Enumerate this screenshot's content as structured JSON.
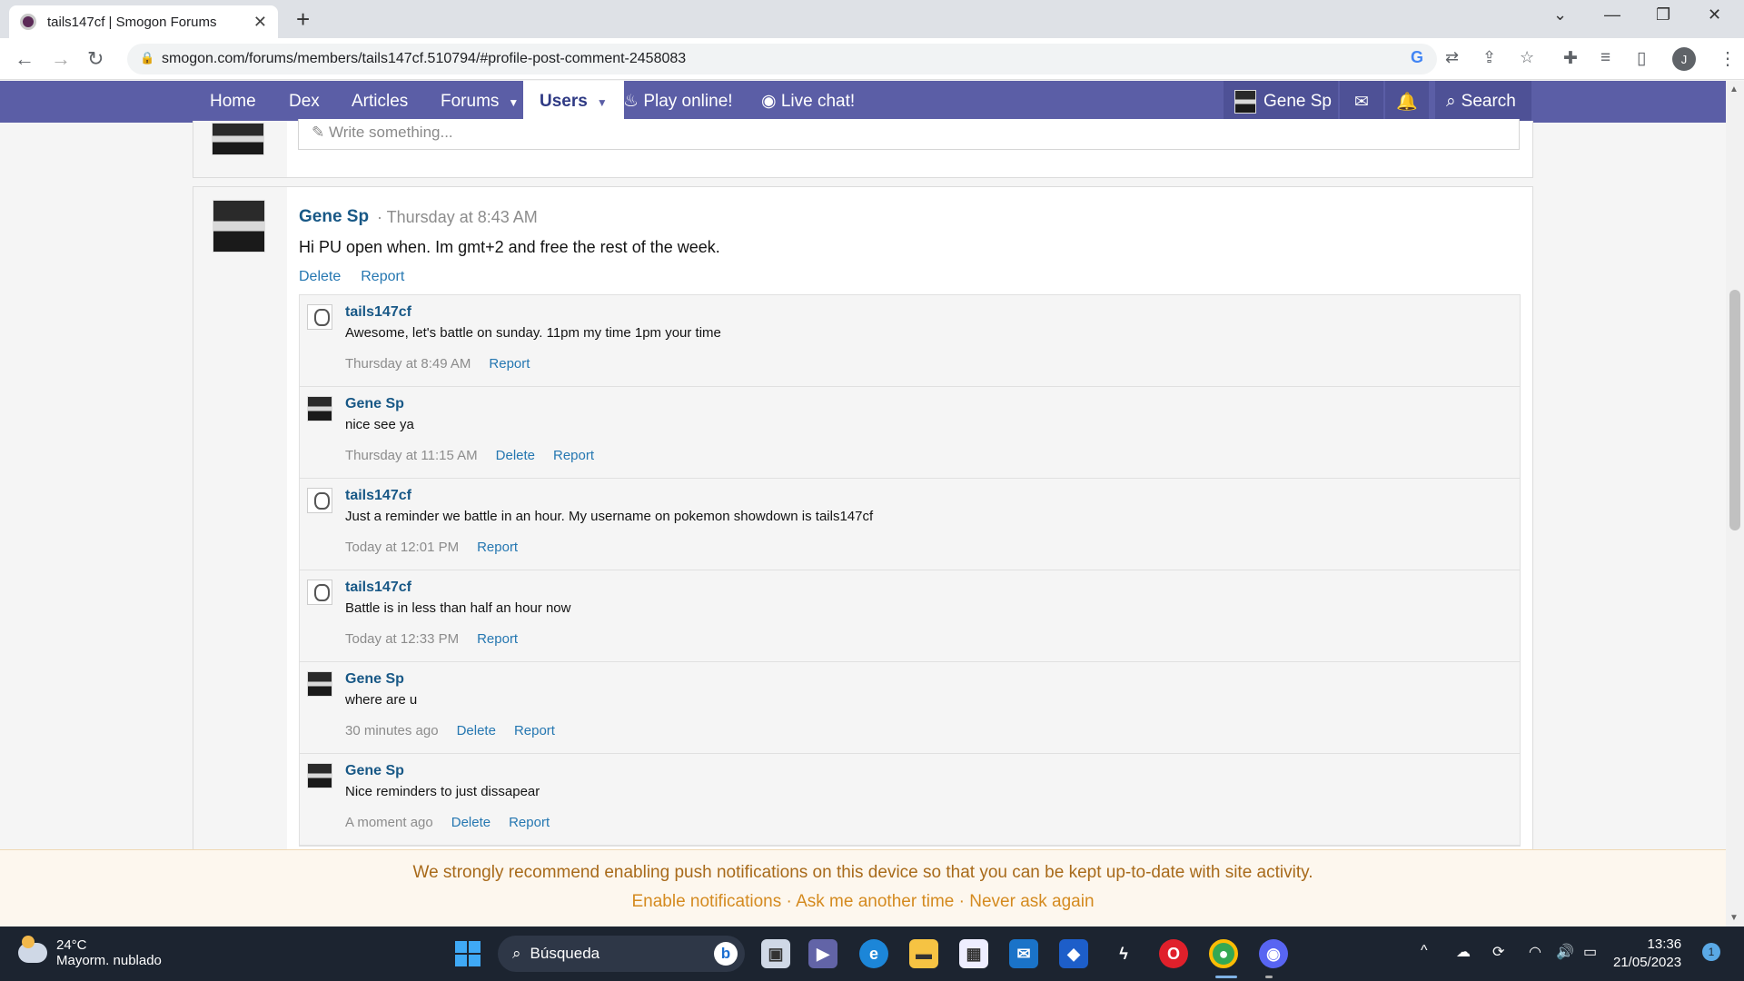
{
  "browser": {
    "tab_title": "tails147cf | Smogon Forums",
    "url": "smogon.com/forums/members/tails147cf.510794/#profile-post-comment-2458083",
    "profile_initial": "J"
  },
  "site_nav": {
    "items": [
      "Home",
      "Dex",
      "Articles",
      "Forums",
      "Users",
      "Play online!",
      "Live chat!"
    ],
    "user": "Gene Sp",
    "search": "Search"
  },
  "composer": {
    "placeholder": "Write something..."
  },
  "post": {
    "author": "Gene Sp",
    "time": "· Thursday at 8:43 AM",
    "text": "Hi PU open when. Im gmt+2 and free the rest of the week.",
    "actions": [
      "Delete",
      "Report"
    ]
  },
  "comments": [
    {
      "author": "tails147cf",
      "text": "Awesome, let's battle on sunday. 11pm my time 1pm your time",
      "time": "Thursday at 8:49 AM",
      "actions": [
        "Report"
      ],
      "avatar": "tails"
    },
    {
      "author": "Gene Sp",
      "text": "nice see ya",
      "time": "Thursday at 11:15 AM",
      "actions": [
        "Delete",
        "Report"
      ],
      "avatar": "gene"
    },
    {
      "author": "tails147cf",
      "text": "Just a reminder we battle in an hour. My username on pokemon showdown is tails147cf",
      "time": "Today at 12:01 PM",
      "actions": [
        "Report"
      ],
      "avatar": "tails"
    },
    {
      "author": "tails147cf",
      "text": "Battle is in less than half an hour now",
      "time": "Today at 12:33 PM",
      "actions": [
        "Report"
      ],
      "avatar": "tails"
    },
    {
      "author": "Gene Sp",
      "text": "where are u",
      "time": "30 minutes ago",
      "actions": [
        "Delete",
        "Report"
      ],
      "avatar": "gene"
    },
    {
      "author": "Gene Sp",
      "text": "Nice reminders to just dissapear",
      "time": "A moment ago",
      "actions": [
        "Delete",
        "Report"
      ],
      "avatar": "gene"
    }
  ],
  "notice": {
    "message": "We strongly recommend enabling push notifications on this device so that you can be kept up-to-date with site activity.",
    "enable": "Enable notifications",
    "later": "Ask me another time",
    "never": "Never ask again",
    "sep": " · "
  },
  "taskbar": {
    "temp": "24°C",
    "weather": "Mayorm. nublado",
    "search": "Búsqueda",
    "time": "13:36",
    "date": "21/05/2023",
    "notif_count": "1"
  }
}
